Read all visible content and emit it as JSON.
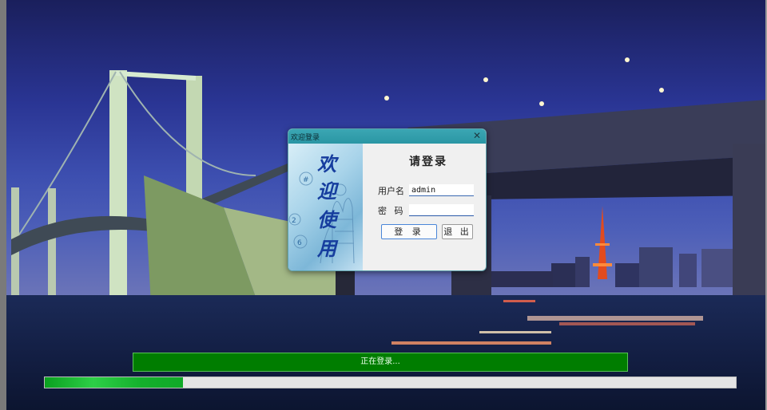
{
  "dialog": {
    "title": "欢迎登录",
    "banner_chars": [
      "欢",
      "迎",
      "使",
      "用"
    ],
    "heading": "请登录",
    "username_label": "用户名",
    "username_value": "admin",
    "password_label": "密 码",
    "password_value": "",
    "login_label": "登 录",
    "exit_label": "退 出"
  },
  "status_text": "正在登录...",
  "progress": {
    "percent": 20
  },
  "colors": {
    "titlebar": "#2a96a4",
    "status_bg": "#007d00",
    "progress_fill": "#2dcf47",
    "sky": "#2a3594"
  }
}
